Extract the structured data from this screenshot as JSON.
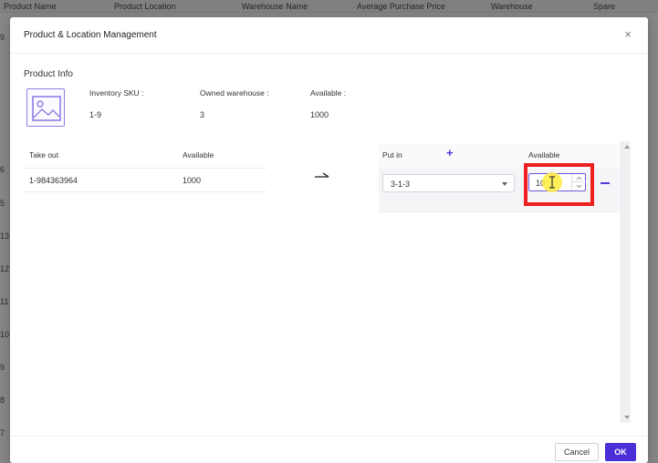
{
  "background_table": {
    "columns": [
      "Product Name",
      "Product Location",
      "Warehouse Name",
      "Average Purchase Price",
      "Warehouse",
      "Spare"
    ],
    "row_numbers": [
      "9",
      "6",
      "5",
      "13",
      "12",
      "11",
      "10",
      "9",
      "8",
      "7"
    ]
  },
  "modal": {
    "title": "Product & Location Management",
    "section_title": "Product Info",
    "image_icon": "image-placeholder-icon",
    "info": {
      "sku_label": "Inventory SKU :",
      "sku_value": "1-9",
      "warehouse_label": "Owned warehouse :",
      "warehouse_value": "3",
      "available_label": "Available :",
      "available_value": "1000"
    },
    "take_out": {
      "header_takeout": "Take out",
      "header_available": "Available",
      "rows": [
        {
          "location": "1-984363964",
          "available": "1000"
        }
      ]
    },
    "put_in": {
      "header_putin": "Put in",
      "header_available": "Available",
      "add_symbol": "+",
      "rows": [
        {
          "location": "3-1-3",
          "quantity": "10"
        }
      ]
    },
    "buttons": {
      "cancel": "Cancel",
      "ok": "OK"
    },
    "close_symbol": "×"
  },
  "colors": {
    "accent": "#4b2fd6",
    "highlight": "#ee2020"
  }
}
